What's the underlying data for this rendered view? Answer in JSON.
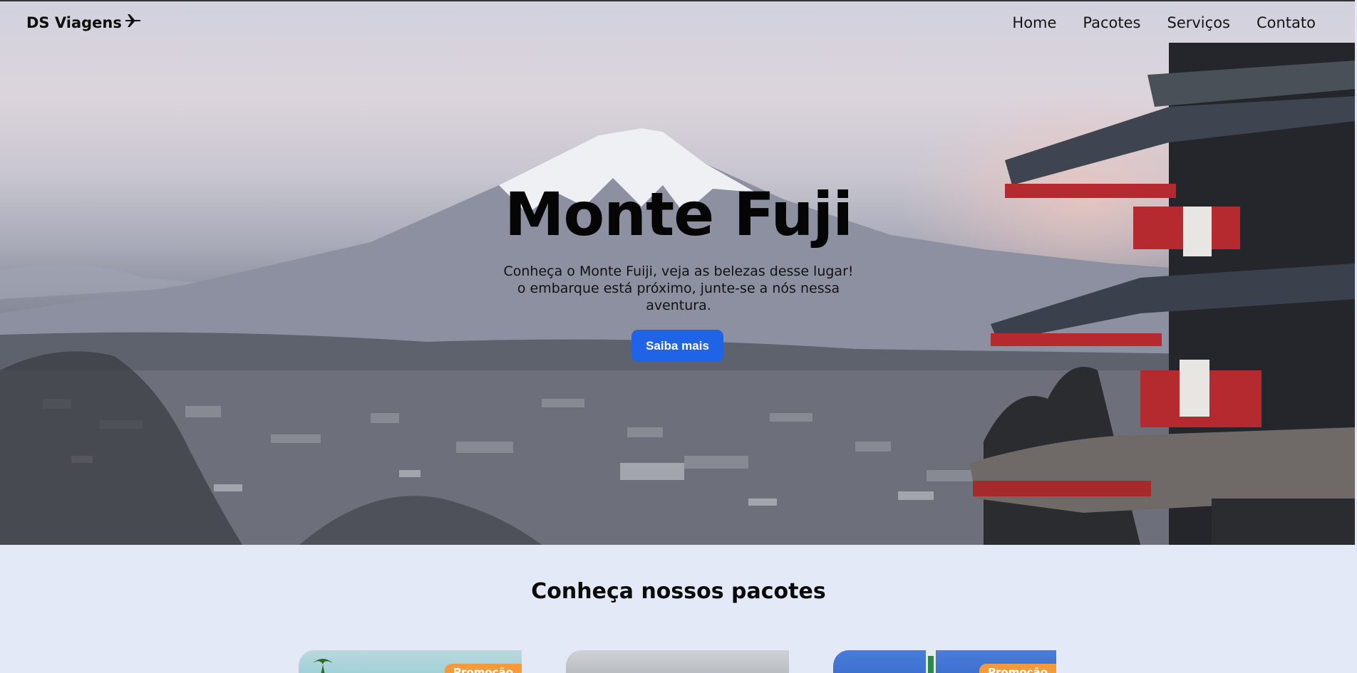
{
  "brand": {
    "name": "DS Viagens",
    "icon": "airplane-icon"
  },
  "nav": {
    "items": [
      "Home",
      "Pacotes",
      "Serviços",
      "Contato"
    ]
  },
  "hero": {
    "title": "Monte Fuji",
    "subtitle": "Conheça o Monte Fuiji, veja as belezas desse lugar! o embarque está próximo, junte-se a nós nessa aventura.",
    "cta_label": "Saiba mais"
  },
  "packages": {
    "title": "Conheça nossos pacotes",
    "cards": [
      {
        "badge": "Promoção"
      },
      {
        "badge": ""
      },
      {
        "badge": "Promoção"
      }
    ]
  },
  "colors": {
    "accent": "#1f63e6",
    "badge": "#f59a3a",
    "section_bg": "#e3e9f7"
  }
}
